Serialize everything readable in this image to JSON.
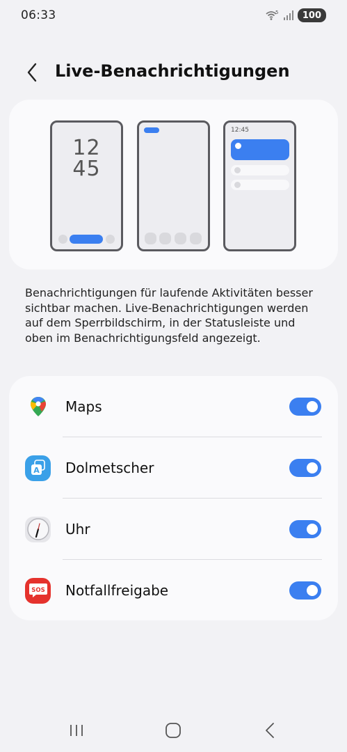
{
  "status": {
    "time": "06:33",
    "wifi_superscript": "5",
    "battery": "100"
  },
  "header": {
    "title": "Live-Benachrichtigungen"
  },
  "illustration": {
    "lock_clock_hours": "12",
    "lock_clock_minutes": "45",
    "panel_time": "12:45"
  },
  "description": "Benachrichtigungen für laufende Aktivitäten besser sichtbar machen. Live-Benachrichtigungen werden auf dem Sperrbildschirm, in der Statusleiste und oben im Benachrichtigungsfeld angezeigt.",
  "apps": [
    {
      "label": "Maps",
      "icon": "google-maps-icon",
      "enabled": true
    },
    {
      "label": "Dolmetscher",
      "icon": "translator-icon",
      "enabled": true
    },
    {
      "label": "Uhr",
      "icon": "clock-icon",
      "enabled": true
    },
    {
      "label": "Notfallfreigabe",
      "icon": "sos-icon",
      "enabled": true
    }
  ],
  "colors": {
    "accent": "#3b7ff0",
    "background": "#f2f2f5",
    "card": "#fafafc"
  }
}
